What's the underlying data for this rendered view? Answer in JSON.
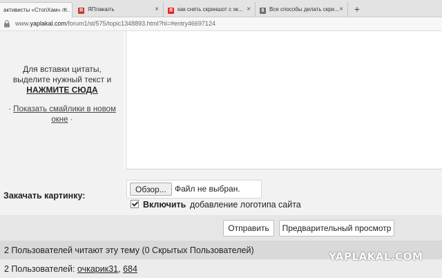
{
  "browser": {
    "tabs": [
      {
        "title": "активисты «СтопХам» п...",
        "favicon": "none",
        "active": true
      },
      {
        "title": "ЯПлакалъ",
        "favicon": "yaplakal-icon",
        "active": false
      },
      {
        "title": "как снять скриншот с эк...",
        "favicon": "yandex-icon",
        "active": false
      },
      {
        "title": "Все способы делать скри...",
        "favicon": "site-icon",
        "active": false
      }
    ],
    "new_tab": "+",
    "close_glyph": "×",
    "url_prefix": "www.",
    "url_host": "yaplakal.com",
    "url_path": "/forum1/st/575/topic1348893.html?hl=#entry46697124"
  },
  "quote": {
    "line1": "Для вставки цитаты,",
    "line2": "выделите нужный текст и",
    "click_label": "НАЖМИТЕ СЮДА"
  },
  "smilies": {
    "bullet": "·",
    "link": "Показать смайлики в новом окне",
    "trailing": "·"
  },
  "upload": {
    "label": "Закачать картинку:",
    "browse_label": "Обзор...",
    "no_file": "Файл не выбран.",
    "logo_bold": "Включить",
    "logo_rest": "добавление логотипа сайта",
    "logo_checked": true
  },
  "buttons": {
    "send": "Отправить",
    "preview": "Предварительный просмотр"
  },
  "readers": {
    "text": "2 Пользователей читают эту тему (0 Скрытых Пользователей)"
  },
  "users": {
    "prefix": "2 Пользователей:",
    "list": [
      "очкарик31",
      "684"
    ]
  },
  "watermark": "YAPLAKAL.COM",
  "colors": {
    "yaplakal_red": "#c0392b",
    "yandex_red": "#e2261c"
  }
}
